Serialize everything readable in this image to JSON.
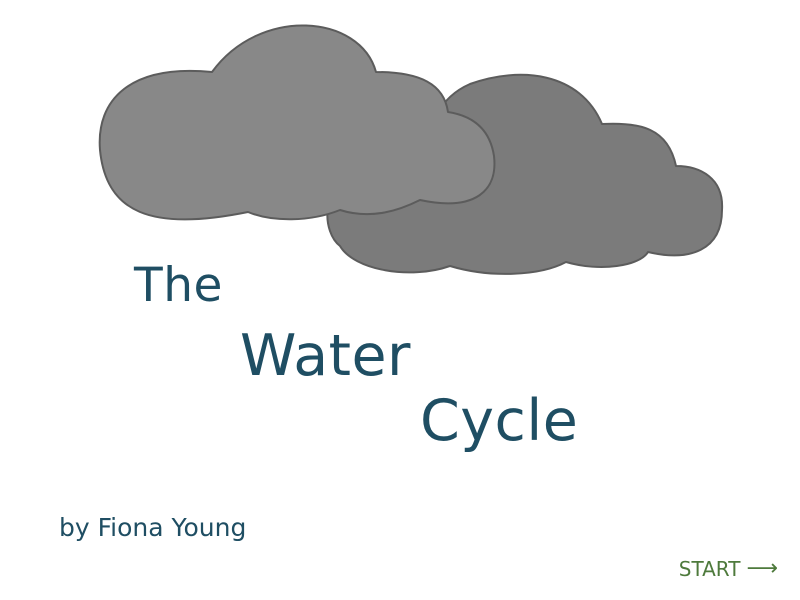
{
  "title": {
    "line1": "The",
    "line2": "Water",
    "line3": "Cycle"
  },
  "author": "by Fiona Young",
  "start_button": {
    "label": "START",
    "icon": "right-arrow-icon",
    "arrow_glyph": "⟶"
  },
  "colors": {
    "title": "#1f4e63",
    "author": "#1f4e63",
    "start": "#4e7a3c",
    "cloud_front_fill": "#888888",
    "cloud_back_fill": "#7b7b7b",
    "cloud_stroke": "#5c5c5c"
  }
}
